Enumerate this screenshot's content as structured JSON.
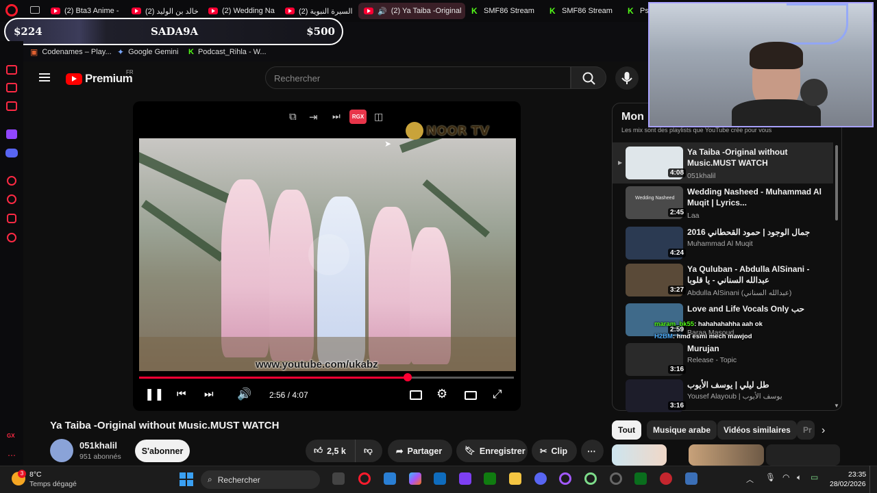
{
  "browser": {
    "tabs": [
      {
        "label": "(2) Bta3 Anime -"
      },
      {
        "label": "(2) خالد بن الوليد"
      },
      {
        "label": "(2) Wedding Na"
      },
      {
        "label": "(2) السيرة النبوية"
      },
      {
        "label": "(2) Ya Taiba -Original"
      },
      {
        "label": "SMF86 Stream"
      },
      {
        "label": "SMF86 Stream"
      },
      {
        "label": "Ps"
      }
    ],
    "bookmarks": [
      {
        "label": "Codenames – Play..."
      },
      {
        "label": "Google Gemini"
      },
      {
        "label": "Podcast_Rihla - W..."
      }
    ]
  },
  "donation": {
    "left": "$224",
    "center": "SADA9A",
    "right": "$500"
  },
  "youtube": {
    "logo_text": "Premium",
    "region": "FR",
    "search_placeholder": "Rechercher"
  },
  "video": {
    "watermark_top": "NOOR TV",
    "watermark_bottom": "www.youtube.com/ukabz",
    "time": "2:56 / 4:07",
    "progress": 0.713,
    "player_badge": "RGX"
  },
  "meta": {
    "title": "Ya Taiba -Original without Music.MUST WATCH",
    "channel": "051khalil",
    "subscribers": "951 abonnés",
    "subscribe_label": "S'abonner",
    "likes": "2,5 k",
    "share_label": "Partager",
    "save_label": "Enregistrer",
    "clip_label": "Clip"
  },
  "mix": {
    "title": "Mon",
    "subtitle": "Les mix sont des playlists que YouTube crée pour vous",
    "items": [
      {
        "title": "Ya Taiba -Original without Music.MUST WATCH",
        "channel": "051khalil",
        "duration": "4:08",
        "thumb_color": "#dfe6ea"
      },
      {
        "title": "Wedding Nasheed - Muhammad Al Muqit | Lyrics...",
        "channel": "Laa",
        "duration": "2:45",
        "thumb_label": "Wedding Nasheed",
        "thumb_color": "#4a4a4a"
      },
      {
        "title": "جمال الوجود | حمود القحطاني 2016",
        "channel": "Muhammad Al Muqit",
        "duration": "4:24",
        "thumb_color": "#2b3a52"
      },
      {
        "title": "Ya Quluban - Abdulla AlSinani - عبدالله السناني - يا قلوبا",
        "channel": "Abdulla AlSinani (عبدالله السناني)",
        "duration": "3:27",
        "thumb_color": "#5a4a38"
      },
      {
        "title": "Love and Life Vocals Only حب",
        "channel": "Baraa Masoud",
        "duration": "2:59",
        "thumb_color": "#3f6a8a"
      },
      {
        "title": "Murujan",
        "channel": "Release - Topic",
        "duration": "3:16",
        "thumb_color": "#2a2a2a"
      },
      {
        "title": "طل ليلي | يوسف الأيوب",
        "channel": "Yousef Alayoub | يوسف الأيوب",
        "duration": "3:16",
        "thumb_color": "#1d1d2a"
      }
    ]
  },
  "chips": [
    {
      "label": "Tout"
    },
    {
      "label": "Musique arabe"
    },
    {
      "label": "Vidéos similaires"
    },
    {
      "label": "Pr"
    }
  ],
  "chat": [
    {
      "user": "maram_bk55",
      "text": ": hahahahahha aah ok",
      "color": "#53fc18"
    },
    {
      "user": "H2BM",
      "text": ": hmd esmi mech mawjod",
      "color": "#4fb0ff"
    }
  ],
  "taskbar": {
    "weather_temp": "8°C",
    "weather_desc": "Temps dégagé",
    "weather_badge": "3",
    "search_label": "Rechercher",
    "time": "23:35",
    "date": "28/02/2026"
  },
  "sidebar_badge": "GX"
}
